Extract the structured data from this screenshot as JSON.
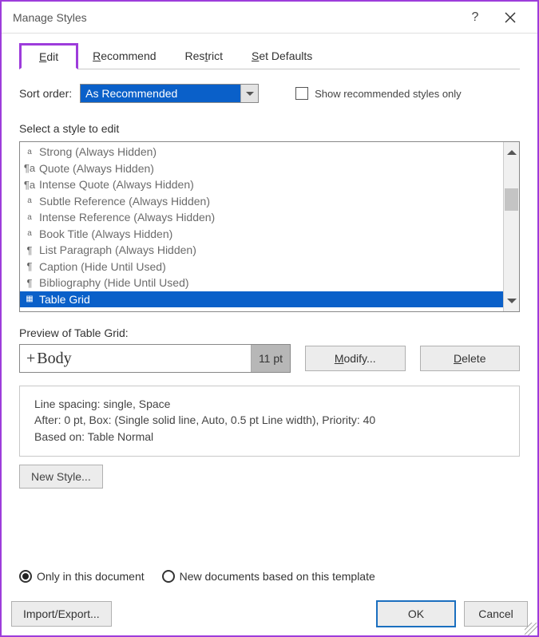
{
  "title": "Manage Styles",
  "tabs": {
    "edit": "Edit",
    "recommend": "Recommend",
    "restrict": "Restrict",
    "set_defaults": "Set Defaults"
  },
  "sort": {
    "label": "Sort order:",
    "selected": "As Recommended",
    "show_recommended_label": "Show recommended styles only"
  },
  "select_label": "Select a style to edit",
  "styles": [
    {
      "icon": "a",
      "name": "Strong",
      "suffix": "(Always Hidden)"
    },
    {
      "icon": "¶a",
      "name": "Quote",
      "suffix": "(Always Hidden)"
    },
    {
      "icon": "¶a",
      "name": "Intense Quote",
      "suffix": "(Always Hidden)"
    },
    {
      "icon": "a",
      "name": "Subtle Reference",
      "suffix": "(Always Hidden)"
    },
    {
      "icon": "a",
      "name": "Intense Reference",
      "suffix": "(Always Hidden)"
    },
    {
      "icon": "a",
      "name": "Book Title",
      "suffix": "(Always Hidden)"
    },
    {
      "icon": "¶",
      "name": "List Paragraph",
      "suffix": "(Always Hidden)"
    },
    {
      "icon": "¶",
      "name": "Caption",
      "suffix": "(Hide Until Used)"
    },
    {
      "icon": "¶",
      "name": "Bibliography",
      "suffix": "(Hide Until Used)"
    },
    {
      "icon": "▦",
      "name": "Table Grid",
      "suffix": ""
    }
  ],
  "selected_style_index": 9,
  "preview": {
    "label": "Preview of Table Grid:",
    "font_sample": "Body",
    "font_size": "11 pt",
    "modify": "Modify...",
    "delete": "Delete"
  },
  "description": {
    "line1": "Line spacing:  single, Space",
    "line2": "After:  0 pt, Box: (Single solid line, Auto,  0.5 pt Line width), Priority: 40",
    "line3": "Based on: Table Normal"
  },
  "new_style": "New Style...",
  "scope": {
    "only_doc": "Only in this document",
    "new_docs": "New documents based on this template"
  },
  "footer": {
    "import_export": "Import/Export...",
    "ok": "OK",
    "cancel": "Cancel"
  }
}
